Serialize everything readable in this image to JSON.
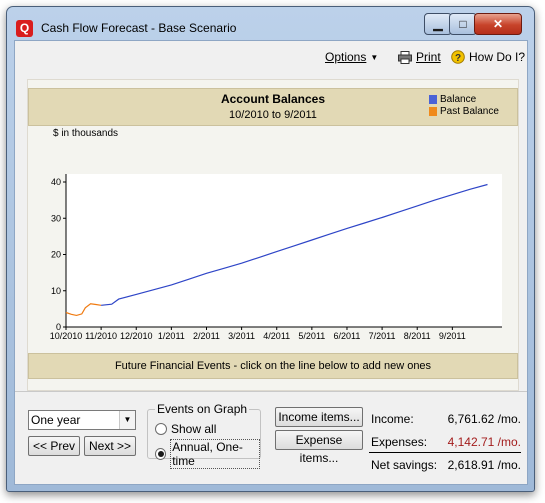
{
  "window": {
    "title": "Cash Flow Forecast - Base Scenario",
    "app_icon_letter": "Q"
  },
  "toolbar": {
    "options": "Options",
    "print": "Print",
    "howdo": "How Do I?"
  },
  "chart_header": {
    "title": "Account Balances",
    "subtitle": "10/2010 to 9/2011"
  },
  "legend": {
    "balance": "Balance",
    "past_balance": "Past Balance"
  },
  "colors": {
    "balance": "#2e45c7",
    "past_balance": "#f07a10",
    "header_bg": "#e2d9b5",
    "event_marker": "#d43a14"
  },
  "chart_data": {
    "type": "line",
    "ylabel": "$ in thousands",
    "ylim": [
      0,
      40
    ],
    "yticks": [
      0,
      10,
      20,
      30,
      40
    ],
    "xlim": [
      0,
      12.3
    ],
    "xticks": [
      {
        "x": 0,
        "label": "10/2010"
      },
      {
        "x": 1,
        "label": "11/2010"
      },
      {
        "x": 2,
        "label": "12/2010"
      },
      {
        "x": 3,
        "label": "1/2011"
      },
      {
        "x": 4,
        "label": "2/2011"
      },
      {
        "x": 5,
        "label": "3/2011"
      },
      {
        "x": 6,
        "label": "4/2011"
      },
      {
        "x": 7,
        "label": "5/2011"
      },
      {
        "x": 8,
        "label": "6/2011"
      },
      {
        "x": 9,
        "label": "7/2011"
      },
      {
        "x": 10,
        "label": "8/2011"
      },
      {
        "x": 11,
        "label": "9/2011"
      }
    ],
    "series": [
      {
        "name": "Past Balance",
        "points": [
          [
            0,
            4.0
          ],
          [
            0.15,
            3.5
          ],
          [
            0.3,
            3.2
          ],
          [
            0.45,
            3.6
          ],
          [
            0.55,
            5.3
          ],
          [
            0.7,
            6.4
          ],
          [
            0.85,
            6.2
          ],
          [
            1.0,
            6.0
          ]
        ]
      },
      {
        "name": "Balance",
        "points": [
          [
            1.0,
            6.0
          ],
          [
            1.3,
            6.3
          ],
          [
            1.5,
            7.7
          ],
          [
            2,
            9.0
          ],
          [
            2.5,
            10.3
          ],
          [
            3,
            11.6
          ],
          [
            3.5,
            13.2
          ],
          [
            4,
            14.8
          ],
          [
            4.5,
            16.2
          ],
          [
            5,
            17.6
          ],
          [
            5.5,
            19.2
          ],
          [
            6,
            20.8
          ],
          [
            6.5,
            22.4
          ],
          [
            7,
            24.0
          ],
          [
            7.5,
            25.6
          ],
          [
            8,
            27.2
          ],
          [
            8.5,
            28.7
          ],
          [
            9,
            30.2
          ],
          [
            9.5,
            31.8
          ],
          [
            10,
            33.4
          ],
          [
            10.5,
            35.0
          ],
          [
            11,
            36.5
          ],
          [
            11.5,
            38.0
          ],
          [
            12.0,
            39.3
          ]
        ]
      }
    ]
  },
  "events_section": {
    "header": "Future Financial Events - click on the line below to add new ones"
  },
  "events_timeline": {
    "marker_months": [
      5.1,
      7.4
    ]
  },
  "controls": {
    "period": "One year",
    "prev": "<< Prev",
    "next": "Next >>",
    "events_group": "Events on Graph",
    "show_all": "Show all",
    "annual_onetime": "Annual, One-time",
    "selected_option": "annual_onetime",
    "income_items": "Income items...",
    "expense_items": "Expense items..."
  },
  "summary": {
    "income_label": "Income:",
    "income_value": "6,761.62 /mo.",
    "expenses_label": "Expenses:",
    "expenses_value": "4,142.71 /mo.",
    "net_label": "Net savings:",
    "net_value": "2,618.91 /mo."
  }
}
